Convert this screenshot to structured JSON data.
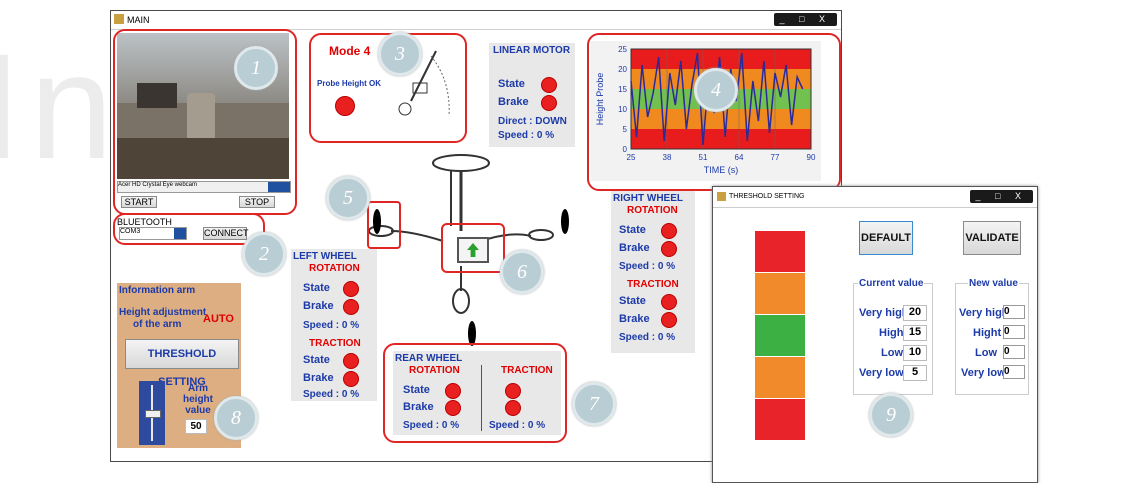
{
  "main_window": {
    "title": "MAIN",
    "controls": "_ □ X"
  },
  "camera": {
    "device": "Acer HD Crystal Eye webcam",
    "start_label": "START",
    "stop_label": "STOP"
  },
  "bluetooth": {
    "title": "BLUETOOTH",
    "port": "COM3",
    "connect_label": "CONNECT"
  },
  "mode": {
    "title": "Mode 4",
    "probe_status": "Probe Height OK"
  },
  "linear_motor": {
    "title": "LINEAR MOTOR",
    "state_label": "State",
    "brake_label": "Brake",
    "direct_text": "Direct : DOWN",
    "speed_text": "Speed : 0 %"
  },
  "chart_data": {
    "type": "line",
    "xlabel": "TIME (s)",
    "ylabel": "Height Probe",
    "xlim": [
      25,
      90
    ],
    "ylim": [
      0,
      25
    ],
    "x_ticks": [
      "25",
      "38",
      "51",
      "64",
      "77",
      "90"
    ],
    "y_ticks": [
      "0",
      "5",
      "10",
      "15",
      "20",
      "25"
    ],
    "bands": [
      {
        "from": 0,
        "to": 5,
        "color": "#e81c1c"
      },
      {
        "from": 5,
        "to": 10,
        "color": "#f08a1e"
      },
      {
        "from": 10,
        "to": 15,
        "color": "#72c050"
      },
      {
        "from": 15,
        "to": 20,
        "color": "#f08a1e"
      },
      {
        "from": 20,
        "to": 25,
        "color": "#e81c1c"
      }
    ],
    "series": [
      {
        "color": "#2a2a9a",
        "x": [
          25,
          27,
          29,
          31,
          33,
          35,
          37,
          39,
          41,
          43,
          45,
          47,
          49,
          51,
          53,
          55,
          57,
          59,
          61,
          63,
          65,
          67,
          69,
          71,
          73,
          75,
          77,
          79,
          81,
          83,
          85,
          87
        ],
        "y": [
          17,
          3,
          21,
          8,
          14,
          23,
          2,
          19,
          11,
          22,
          5,
          16,
          24,
          1,
          18,
          9,
          23,
          3,
          20,
          12,
          24,
          2,
          17,
          7,
          22,
          4,
          19,
          13,
          21,
          6,
          18,
          15
        ]
      }
    ]
  },
  "left_wheel": {
    "title": "LEFT WHEEL",
    "rotation_title": "ROTATION",
    "traction_title": "TRACTION",
    "state_label": "State",
    "brake_label": "Brake",
    "speed_text": "Speed : 0 %"
  },
  "right_wheel": {
    "title": "RIGHT WHEEL",
    "rotation_title": "ROTATION",
    "traction_title": "TRACTION",
    "state_label": "State",
    "brake_label": "Brake",
    "speed_text": "Speed : 0 %"
  },
  "rear_wheel": {
    "title": "REAR WHEEL",
    "rotation_title": "ROTATION",
    "traction_title": "TRACTION",
    "state_label": "State",
    "brake_label": "Brake",
    "speed_text": "Speed : 0 %"
  },
  "info_arm": {
    "title": "Information arm",
    "height_adj_line1": "Height adjustment",
    "height_adj_line2": "of the arm",
    "mode_value": "AUTO",
    "threshold_button": "THRESHOLD SETTING",
    "arm_label_1": "Arm",
    "arm_label_2": "height",
    "arm_label_3": "value",
    "arm_value": "50",
    "slider_level": 0.5
  },
  "threshold_window": {
    "title": "THRESHOLD SETTING",
    "controls": "_ □ X",
    "default_label": "DEFAULT",
    "validate_label": "VALIDATE",
    "current_title": "Current value",
    "new_title": "New value",
    "rows": [
      {
        "label": "Very hight",
        "current": "20",
        "new": "0"
      },
      {
        "label": "Hight",
        "current": "15",
        "new": "0"
      },
      {
        "label": "Low",
        "current": "10",
        "new": "0"
      },
      {
        "label": "Very low",
        "current": "5",
        "new": "0"
      }
    ],
    "bar_colors": [
      "#e8242a",
      "#f08a2a",
      "#3cb043",
      "#f08a2a",
      "#e8242a"
    ]
  },
  "callouts": [
    "1",
    "2",
    "3",
    "4",
    "5",
    "6",
    "7",
    "8",
    "9"
  ],
  "watermark": "In"
}
